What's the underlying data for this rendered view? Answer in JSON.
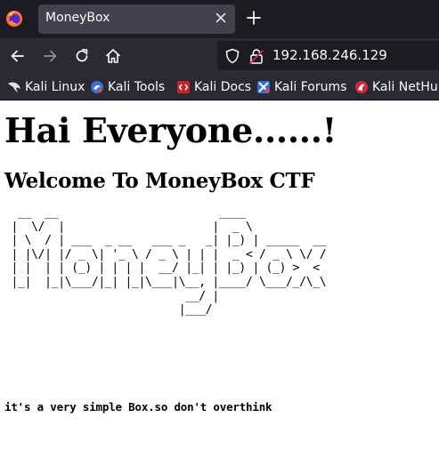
{
  "browser": {
    "tab": {
      "title": "MoneyBox",
      "close_icon": "close-icon"
    },
    "new_tab_icon": "plus-icon",
    "nav": {
      "back_icon": "arrow-left-icon",
      "forward_icon": "arrow-right-icon",
      "reload_icon": "reload-icon",
      "home_icon": "home-icon"
    },
    "url": "192.168.246.129",
    "bookmarks": [
      {
        "label": "Kali Linux",
        "icon": "kali-dragon-icon"
      },
      {
        "label": "Kali Tools",
        "icon": "kali-tools-icon"
      },
      {
        "label": "Kali Docs",
        "icon": "kali-docs-icon"
      },
      {
        "label": "Kali Forums",
        "icon": "kali-forums-icon"
      },
      {
        "label": "Kali NetHunter",
        "icon": "kali-nethunter-icon"
      }
    ]
  },
  "page": {
    "heading": "Hai Everyone......!",
    "subheading": "Welcome To MoneyBox CTF",
    "ascii_art": "  __  __                        ____\n |  \\/  |                      |  _ \\\n | \\  / | ___  _ __   ___ _   _| |_) | _____  __\n | |\\/| |/ _ \\| '_ \\ / _ \\ | | |  _ < / _ \\ \\/ /\n | |  | | (_) | | | |  __/ |_| | |_) | (_) >  <\n |_|  |_|\\___/|_| |_|\\___|\\__, |____/ \\___/_/\\_\\\n                           __/ |\n                          |___/",
    "hint": "it's a very simple Box.so don't overthink"
  },
  "colors": {
    "tabstrip": "#1c1b22",
    "toolbar": "#2b2a33",
    "active_tab": "#42414d",
    "chrome_text": "#fbfbfe",
    "page_bg": "#ffffff",
    "page_text": "#000000"
  }
}
